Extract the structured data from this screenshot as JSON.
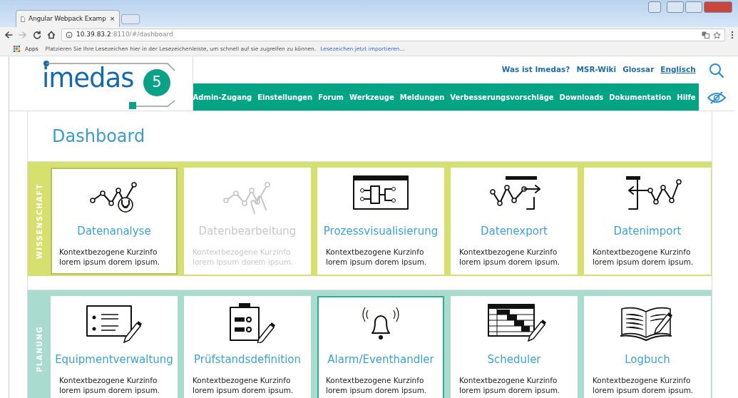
{
  "browser": {
    "tab_title": "Angular Webpack Examp",
    "tab_close": "×",
    "url_host": "10.39.83.2",
    "url_rest": ":8110/#/dashboard",
    "apps": "Apps",
    "bookmark_hint": "Platzieren Sie Ihre Lesezeichen hier in der Lesezeichenleiste, um schnell auf sie zugreifen zu können.",
    "bookmark_link": "Lesezeichen jetzt importieren..."
  },
  "header": {
    "logo": {
      "word": "imedas",
      "version": "5"
    },
    "top_links": [
      {
        "label": "Was ist Imedas?",
        "underlined": false
      },
      {
        "label": "MSR-Wiki",
        "underlined": false
      },
      {
        "label": "Glossar",
        "underlined": false
      },
      {
        "label": "Englisch",
        "underlined": true
      }
    ],
    "nav": [
      "Admin-Zugang",
      "Einstellungen",
      "Forum",
      "Werkzeuge",
      "Meldungen",
      "Verbesserungsvorschläge",
      "Downloads",
      "Dokumentation",
      "Hilfe"
    ]
  },
  "page_title": "Dashboard",
  "sections": [
    {
      "label": "WISSENSCHAFT",
      "color": "#d5e06f",
      "tiles": [
        {
          "title": "Datenanalyse",
          "text": "Kontextbezogene Kurzinfo\nlorem ipsum dorem ipsum.",
          "selected": true,
          "disabled": false
        },
        {
          "title": "Datenbearbeitung",
          "text": "Kontextbezogene Kurzinfo\nlorem ipsum dorem ipsum.",
          "selected": false,
          "disabled": true
        },
        {
          "title": "Prozessvisualisierung",
          "text": "Kontextbezogene Kurzinfo\nlorem ipsum dorem ipsum.",
          "selected": false,
          "disabled": false
        },
        {
          "title": "Datenexport",
          "text": "Kontextbezogene Kurzinfo\nlorem ipsum dorem ipsum.",
          "selected": false,
          "disabled": false
        },
        {
          "title": "Datenimport",
          "text": "Kontextbezogene Kurzinfo\nlorem ipsum dorem ipsum.",
          "selected": false,
          "disabled": false
        }
      ]
    },
    {
      "label": "PLANUNG",
      "color": "#a9dccf",
      "tiles": [
        {
          "title": "Equipmentverwaltung",
          "text": "Kontextbezogene Kurzinfo\nlorem ipsum dorem ipsum.",
          "selected": false,
          "disabled": false
        },
        {
          "title": "Prüfstandsdefinition",
          "text": "Kontextbezogene Kurzinfo\nlorem ipsum dorem ipsum.",
          "selected": false,
          "disabled": false
        },
        {
          "title": "Alarm/Eventhandler",
          "text": "Kontextbezogene Kurzinfo\nlorem ipsum dorem ipsum.",
          "selected": true,
          "disabled": false
        },
        {
          "title": "Scheduler",
          "text": "Kontextbezogene Kurzinfo\nlorem ipsum dorem ipsum.",
          "selected": false,
          "disabled": false
        },
        {
          "title": "Logbuch",
          "text": "Kontextbezogene Kurzinfo\nlorem ipsum dorem ipsum.",
          "selected": false,
          "disabled": false
        }
      ]
    }
  ]
}
